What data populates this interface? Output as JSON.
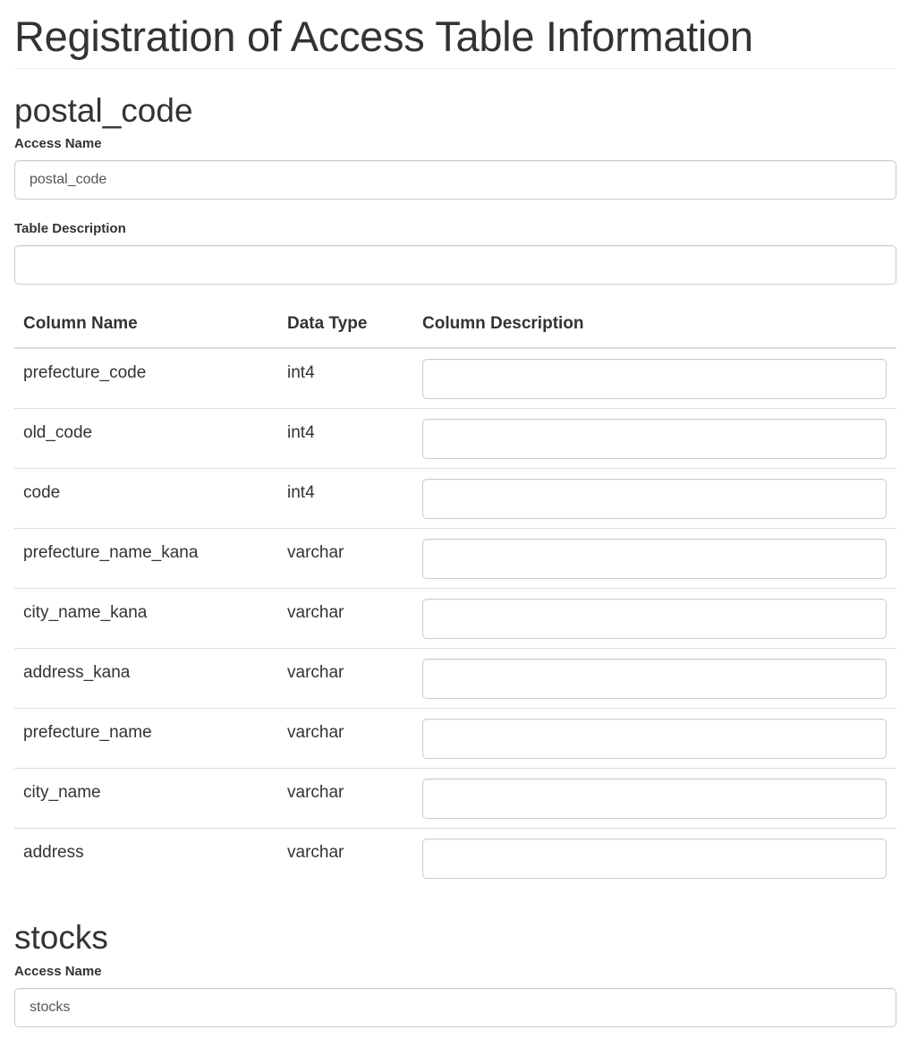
{
  "page": {
    "title": "Registration of Access Table Information"
  },
  "tables": [
    {
      "name": "postal_code",
      "access_name_label": "Access Name",
      "access_name_value": "postal_code",
      "description_label": "Table Description",
      "description_value": "",
      "headers": {
        "column_name": "Column Name",
        "data_type": "Data Type",
        "column_description": "Column Description"
      },
      "columns": [
        {
          "name": "prefecture_code",
          "type": "int4",
          "description": ""
        },
        {
          "name": "old_code",
          "type": "int4",
          "description": ""
        },
        {
          "name": "code",
          "type": "int4",
          "description": ""
        },
        {
          "name": "prefecture_name_kana",
          "type": "varchar",
          "description": ""
        },
        {
          "name": "city_name_kana",
          "type": "varchar",
          "description": ""
        },
        {
          "name": "address_kana",
          "type": "varchar",
          "description": ""
        },
        {
          "name": "prefecture_name",
          "type": "varchar",
          "description": ""
        },
        {
          "name": "city_name",
          "type": "varchar",
          "description": ""
        },
        {
          "name": "address",
          "type": "varchar",
          "description": ""
        }
      ]
    },
    {
      "name": "stocks",
      "access_name_label": "Access Name",
      "access_name_value": "stocks"
    }
  ]
}
